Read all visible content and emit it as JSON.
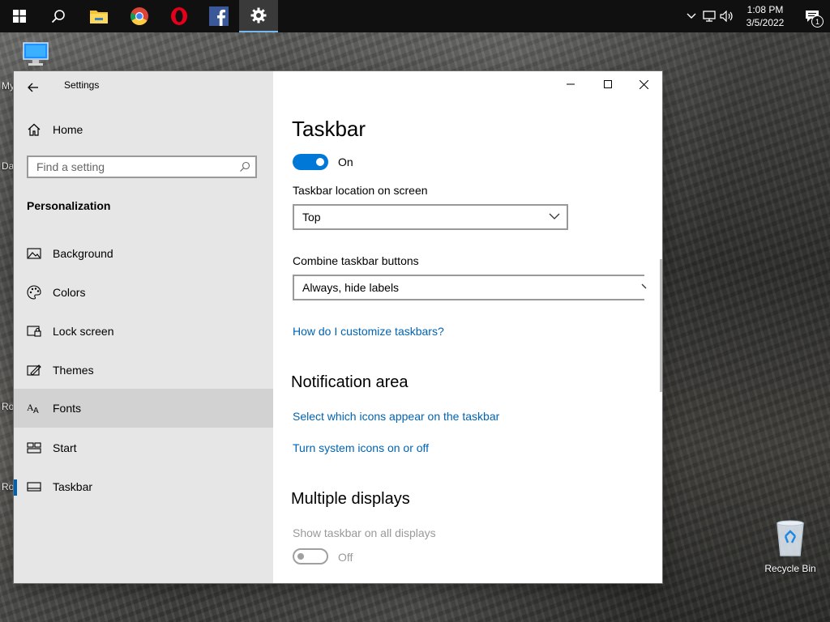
{
  "taskbar": {
    "apps": [
      {
        "id": "start",
        "icon": "windows-logo-icon"
      },
      {
        "id": "search",
        "icon": "search-icon"
      },
      {
        "id": "file-explorer",
        "icon": "folder-icon"
      },
      {
        "id": "chrome",
        "icon": "chrome-icon"
      },
      {
        "id": "opera",
        "icon": "opera-icon"
      },
      {
        "id": "facebook",
        "icon": "facebook-icon"
      },
      {
        "id": "settings",
        "icon": "gear-icon",
        "active": true
      }
    ],
    "clock": {
      "time": "1:08 PM",
      "date": "3/5/2022"
    },
    "notification_count": "1"
  },
  "desktop": {
    "icons": [
      {
        "label": "My"
      },
      {
        "label": "Da"
      },
      {
        "label": "Ro"
      },
      {
        "label": "Ro"
      },
      {
        "label": "Recycle Bin"
      }
    ]
  },
  "window": {
    "title": "Settings",
    "sidebar": {
      "home_label": "Home",
      "search_placeholder": "Find a setting",
      "section_heading": "Personalization",
      "items": [
        {
          "label": "Background",
          "icon": "picture-icon"
        },
        {
          "label": "Colors",
          "icon": "palette-icon"
        },
        {
          "label": "Lock screen",
          "icon": "lock-screen-icon"
        },
        {
          "label": "Themes",
          "icon": "themes-icon"
        },
        {
          "label": "Fonts",
          "icon": "fonts-icon"
        },
        {
          "label": "Start",
          "icon": "start-icon"
        },
        {
          "label": "Taskbar",
          "icon": "taskbar-icon",
          "selected": true
        }
      ]
    },
    "content": {
      "title": "Taskbar",
      "main_toggle": {
        "state_label": "On",
        "on": true
      },
      "location": {
        "label": "Taskbar location on screen",
        "value": "Top"
      },
      "combine": {
        "label": "Combine taskbar buttons",
        "value": "Always, hide labels"
      },
      "customize_link": "How do I customize taskbars?",
      "notification_area": {
        "heading": "Notification area",
        "links": [
          "Select which icons appear on the taskbar",
          "Turn system icons on or off"
        ]
      },
      "multiple_displays": {
        "heading": "Multiple displays",
        "show_all_label": "Show taskbar on all displays",
        "show_all_toggle": {
          "state_label": "Off",
          "on": false
        }
      }
    }
  },
  "colors": {
    "accent": "#0078d7",
    "link": "#0063b1",
    "sidebar_bg": "#e6e6e6",
    "taskbar_bg": "#101010"
  }
}
